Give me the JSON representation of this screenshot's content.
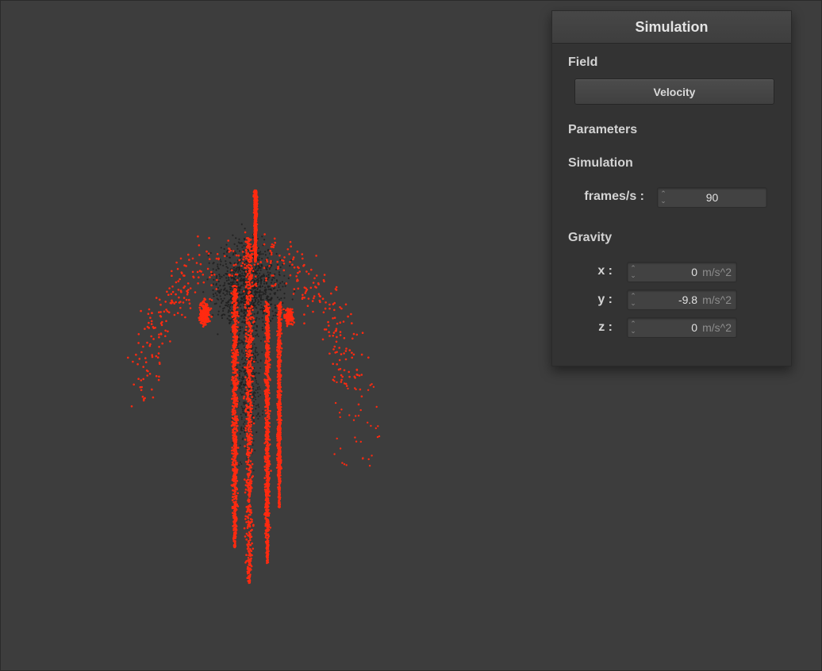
{
  "panel": {
    "title": "Simulation",
    "field_label": "Field",
    "field_button": "Velocity",
    "parameters_label": "Parameters",
    "simulation_label": "Simulation",
    "fps": {
      "label": "frames/s :",
      "value": "90"
    },
    "gravity_label": "Gravity",
    "gravity": [
      {
        "label": "x :",
        "value": "0",
        "unit": "m/s^2"
      },
      {
        "label": "y :",
        "value": "-9.8",
        "unit": "m/s^2"
      },
      {
        "label": "z :",
        "value": "0",
        "unit": "m/s^2"
      }
    ]
  },
  "colors": {
    "background": "#3d3d3d",
    "particle_fast": "#ff2a10",
    "particle_slow": "#1e1e1e",
    "panel": "#333333"
  },
  "icons": {
    "spin_arrows": "up-down-arrows-icon"
  }
}
